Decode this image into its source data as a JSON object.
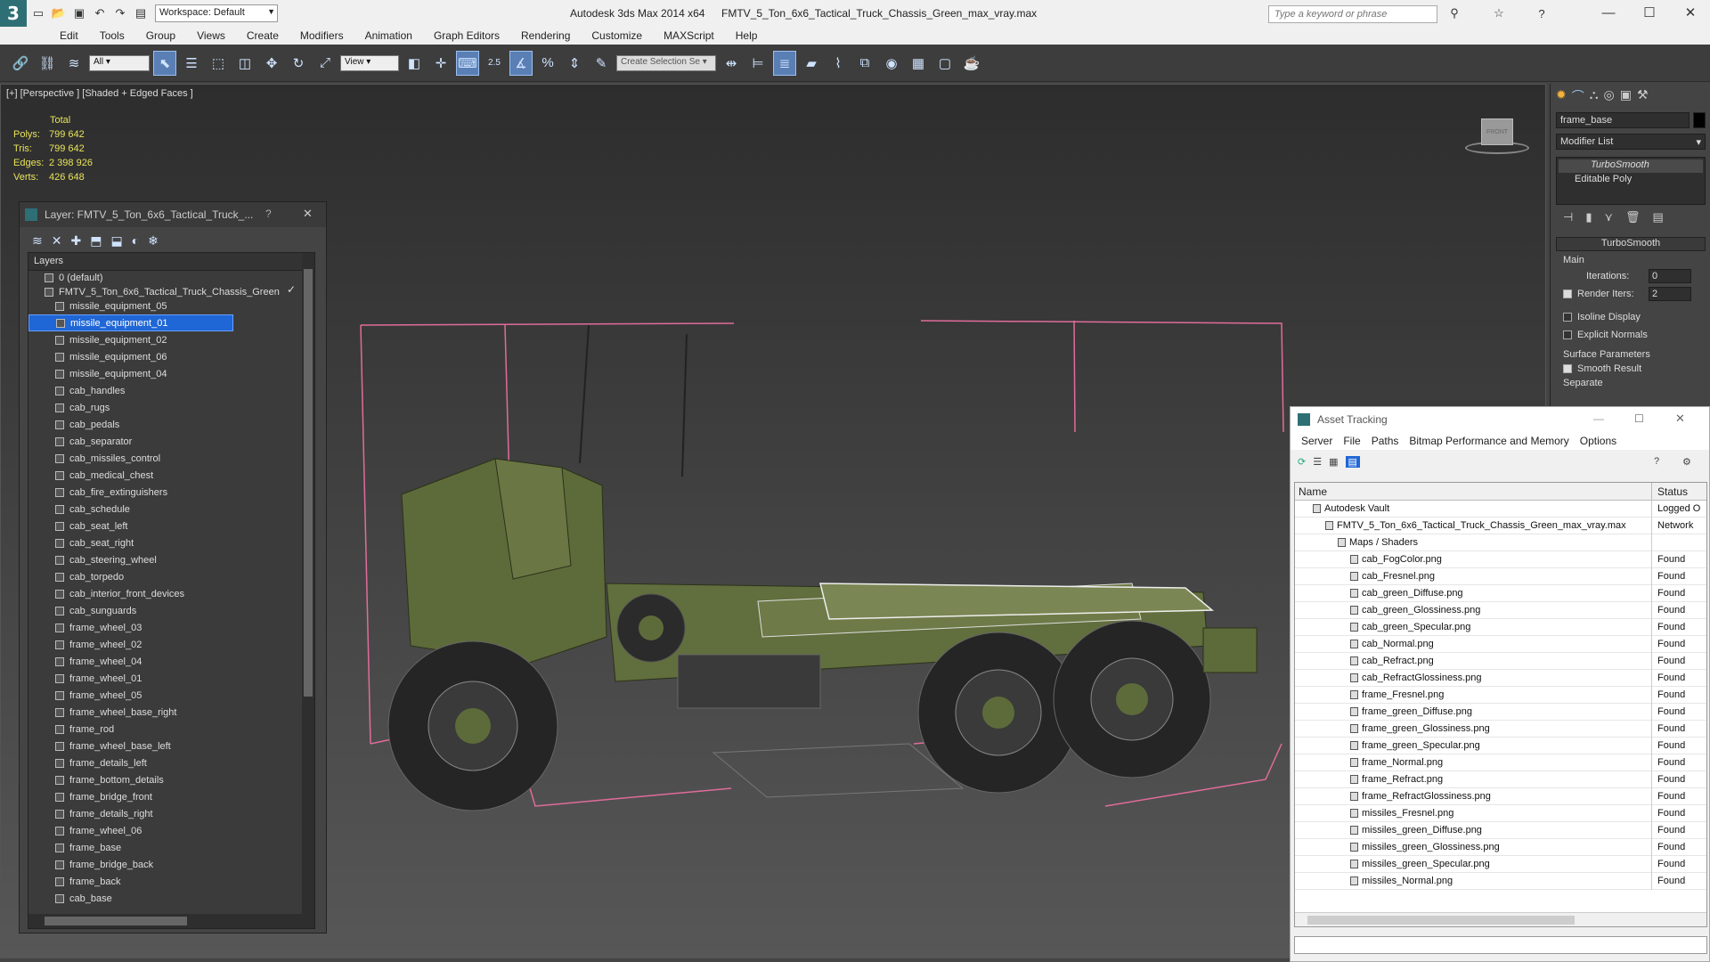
{
  "titlebar": {
    "workspace": "Workspace: Default",
    "app": "Autodesk 3ds Max  2014 x64",
    "file": "FMTV_5_Ton_6x6_Tactical_Truck_Chassis_Green_max_vray.max",
    "search_placeholder": "Type a keyword or phrase"
  },
  "menu": [
    "Edit",
    "Tools",
    "Group",
    "Views",
    "Create",
    "Modifiers",
    "Animation",
    "Graph Editors",
    "Rendering",
    "Customize",
    "MAXScript",
    "Help"
  ],
  "toolbar": {
    "filter": "All",
    "refcoord": "View",
    "selection_set": "Create Selection Se",
    "snap_angle": "2.5"
  },
  "viewport": {
    "label": "[+] [Perspective ] [Shaded + Edged Faces ]",
    "stats": {
      "header": "Total",
      "rows": [
        {
          "label": "Polys:",
          "value": "799 642"
        },
        {
          "label": "Tris:",
          "value": "799 642"
        },
        {
          "label": "Edges:",
          "value": "2 398 926"
        },
        {
          "label": "Verts:",
          "value": "426 648"
        }
      ]
    },
    "viewcube_label": "FRONT"
  },
  "layer_window": {
    "title": "Layer: FMTV_5_Ton_6x6_Tactical_Truck_...",
    "help": "?",
    "header": "Layers",
    "default_layer": "0 (default)",
    "root": "FMTV_5_Ton_6x6_Tactical_Truck_Chassis_Green",
    "selected": "missile_equipment_01",
    "layers": [
      "missile_equipment_05",
      "missile_equipment_01",
      "missile_equipment_02",
      "missile_equipment_06",
      "missile_equipment_04",
      "cab_handles",
      "cab_rugs",
      "cab_pedals",
      "cab_separator",
      "cab_missiles_control",
      "cab_medical_chest",
      "cab_fire_extinguishers",
      "cab_schedule",
      "cab_seat_left",
      "cab_seat_right",
      "cab_steering_wheel",
      "cab_torpedo",
      "cab_interior_front_devices",
      "cab_sunguards",
      "frame_wheel_03",
      "frame_wheel_02",
      "frame_wheel_04",
      "frame_wheel_01",
      "frame_wheel_05",
      "frame_wheel_base_right",
      "frame_rod",
      "frame_wheel_base_left",
      "frame_details_left",
      "frame_bottom_details",
      "frame_bridge_front",
      "frame_details_right",
      "frame_wheel_06",
      "frame_base",
      "frame_bridge_back",
      "frame_back",
      "cab_base"
    ]
  },
  "command_panel": {
    "object_name": "frame_base",
    "modifier_list": "Modifier List",
    "stack": [
      "TurboSmooth",
      "Editable Poly"
    ],
    "rollout_title": "TurboSmooth",
    "main_label": "Main",
    "iterations_label": "Iterations:",
    "iterations": "0",
    "render_iters_label": "Render Iters:",
    "render_iters": "2",
    "isoline": "Isoline Display",
    "explicit": "Explicit Normals",
    "surface_label": "Surface Parameters",
    "smooth_result": "Smooth Result",
    "separate": "Separate"
  },
  "asset_tracking": {
    "title": "Asset Tracking",
    "menu": [
      "Server",
      "File",
      "Paths",
      "Bitmap Performance and Memory",
      "Options"
    ],
    "col_name": "Name",
    "col_status": "Status",
    "rows": [
      {
        "name": "Autodesk Vault",
        "status": "Logged O",
        "indent": 1
      },
      {
        "name": "FMTV_5_Ton_6x6_Tactical_Truck_Chassis_Green_max_vray.max",
        "status": "Network",
        "indent": 2
      },
      {
        "name": "Maps / Shaders",
        "status": "",
        "indent": 3
      },
      {
        "name": "cab_FogColor.png",
        "status": "Found",
        "indent": 4
      },
      {
        "name": "cab_Fresnel.png",
        "status": "Found",
        "indent": 4
      },
      {
        "name": "cab_green_Diffuse.png",
        "status": "Found",
        "indent": 4
      },
      {
        "name": "cab_green_Glossiness.png",
        "status": "Found",
        "indent": 4
      },
      {
        "name": "cab_green_Specular.png",
        "status": "Found",
        "indent": 4
      },
      {
        "name": "cab_Normal.png",
        "status": "Found",
        "indent": 4
      },
      {
        "name": "cab_Refract.png",
        "status": "Found",
        "indent": 4
      },
      {
        "name": "cab_RefractGlossiness.png",
        "status": "Found",
        "indent": 4
      },
      {
        "name": "frame_Fresnel.png",
        "status": "Found",
        "indent": 4
      },
      {
        "name": "frame_green_Diffuse.png",
        "status": "Found",
        "indent": 4
      },
      {
        "name": "frame_green_Glossiness.png",
        "status": "Found",
        "indent": 4
      },
      {
        "name": "frame_green_Specular.png",
        "status": "Found",
        "indent": 4
      },
      {
        "name": "frame_Normal.png",
        "status": "Found",
        "indent": 4
      },
      {
        "name": "frame_Refract.png",
        "status": "Found",
        "indent": 4
      },
      {
        "name": "frame_RefractGlossiness.png",
        "status": "Found",
        "indent": 4
      },
      {
        "name": "missiles_Fresnel.png",
        "status": "Found",
        "indent": 4
      },
      {
        "name": "missiles_green_Diffuse.png",
        "status": "Found",
        "indent": 4
      },
      {
        "name": "missiles_green_Glossiness.png",
        "status": "Found",
        "indent": 4
      },
      {
        "name": "missiles_green_Specular.png",
        "status": "Found",
        "indent": 4
      },
      {
        "name": "missiles_Normal.png",
        "status": "Found",
        "indent": 4
      }
    ]
  },
  "colors": {
    "selection": "#1f66d6",
    "stats": "#e8e35a",
    "bbox": "#e06c9a",
    "truck": "#5d6b3a"
  }
}
